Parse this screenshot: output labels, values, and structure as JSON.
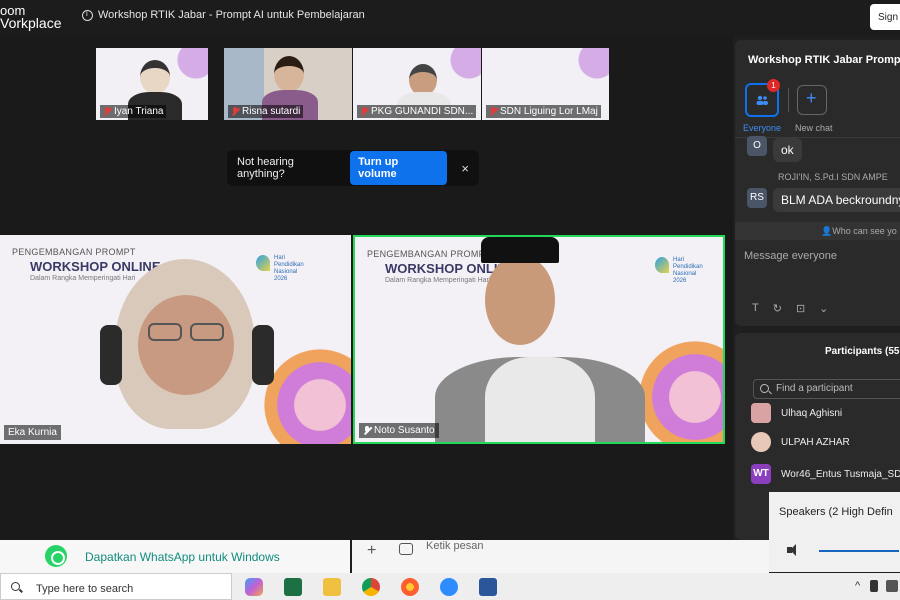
{
  "app": {
    "brand_line1": "oom",
    "brand_line2": "Vorkplace",
    "meeting_title": "Workshop RTIK Jabar - Prompt AI untuk Pembelajaran",
    "sign_in": "Sign"
  },
  "thumbnails": [
    {
      "name": "Iyan Triana"
    },
    {
      "name": "Risna sutardi"
    },
    {
      "name": "PKG GUNANDI SDN..."
    },
    {
      "name": "SDN Liguing Lor LMaj"
    }
  ],
  "toast": {
    "text": "Not hearing anything?",
    "button": "Turn up volume",
    "close": "×"
  },
  "tiles": [
    {
      "name": "Eka Kurnia",
      "slide_head": "PENGEMBANGAN PROMPT",
      "slide_big": "WORKSHOP ONLINE",
      "slide_sub": "Dalam Rangka Memperingati Hari"
    },
    {
      "name": "Noto Susanto",
      "slide_head": "PENGEMBANGAN PROMPT    AJARAN",
      "slide_big": "WORKSHOP ONLINE",
      "slide_sub": "Dalam Rangka Memperingati Hari"
    }
  ],
  "slide_logo": {
    "text1": "Hari",
    "text2": "Pendidikan",
    "text3": "Nasional",
    "text4": "2026"
  },
  "chat": {
    "title": "Workshop RTIK Jabar   Prompt",
    "badge": "1",
    "tab_everyone": "Everyone",
    "tab_new": "New chat",
    "messages": [
      {
        "avatar": "O",
        "sender": "",
        "text": "ok"
      },
      {
        "avatar": "RS",
        "sender": "ROJI'IN, S.Pd.I SDN AMPE",
        "text": "BLM ADA beckroundny"
      }
    ],
    "who_can_see": "Who can see yo",
    "input_placeholder": "Message everyone",
    "format_icons": [
      "T",
      "↻",
      "⊡",
      "⌄"
    ]
  },
  "participants": {
    "title": "Participants (55",
    "search_placeholder": "Find a participant",
    "list": [
      {
        "name": "Ulhaq Aghisni",
        "avatar_color": "#d9a3a3"
      },
      {
        "name": "ULPAH AZHAR",
        "avatar_color": "#e8c9b8"
      },
      {
        "name": "Wor46_Entus Tusmaja_SD",
        "avatar_text": "WT",
        "avatar_color": "#8b3fbf"
      }
    ]
  },
  "speaker": {
    "label": "Speakers (2   High Defin"
  },
  "whatsapp": {
    "text": "Dapatkan WhatsApp untuk Windows"
  },
  "chat_bottom": {
    "plus": "+",
    "placeholder": "Ketik pesan"
  },
  "taskbar": {
    "search": "Type here to search",
    "tray_up": "^"
  }
}
